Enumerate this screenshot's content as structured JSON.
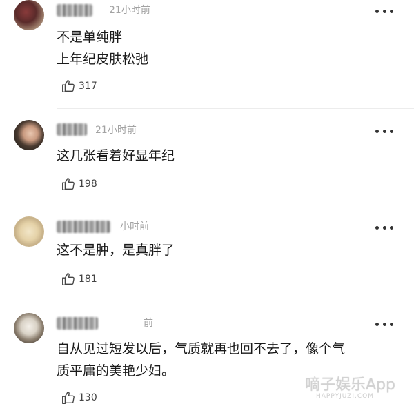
{
  "comments": [
    {
      "time": "21小时前",
      "lines": [
        "不是单纯胖",
        "上年纪皮肤松弛"
      ],
      "likes": "317"
    },
    {
      "time": "21小时前",
      "lines": [
        "这几张看着好显年纪"
      ],
      "likes": "198"
    },
    {
      "time": "小时前",
      "lines": [
        "这不是肿，是真胖了"
      ],
      "likes": "181"
    },
    {
      "time": "前",
      "lines": [
        "自从见过短发以后，气质就再也回不去了，像个气",
        "质平庸的美艳少妇。"
      ],
      "likes": "130"
    }
  ],
  "watermark": {
    "main": "嘀子娱乐App",
    "sub": "HAPPYJUZI.COM"
  },
  "colors": {
    "time": "#a3a3a3",
    "divider": "#ececec",
    "text": "#1a1a1a"
  },
  "icons": {
    "like": "thumbs-up-icon",
    "more": "more-dots-icon"
  }
}
